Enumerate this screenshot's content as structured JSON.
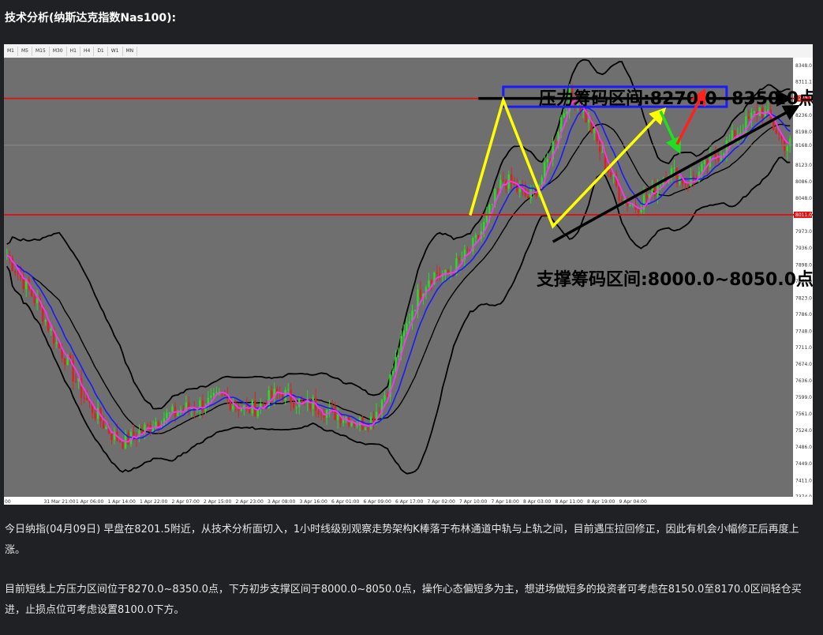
{
  "heading": "技术分析(纳斯达克指数Nas100):",
  "timeframes": [
    "M1",
    "M5",
    "M15",
    "M30",
    "H1",
    "H4",
    "D1",
    "W1",
    "MN"
  ],
  "annotations": {
    "resistance": "压力筹码区间:8270.0~8350.0点",
    "support": "支撑筹码区间:8000.0~8050.0点"
  },
  "price_labels": [
    "8348.0",
    "8311.1",
    "8273.7",
    "8236.0",
    "8198.0",
    "8168.0",
    "8123.0",
    "8086.0",
    "8048.0",
    "8011.0",
    "7973.0",
    "7936.0",
    "7898.0",
    "7861.0",
    "7823.0",
    "7786.0",
    "7748.0",
    "7711.0",
    "7674.0",
    "7636.0",
    "7599.0",
    "7561.0",
    "7524.0",
    "7486.0",
    "7449.0",
    "7411.0",
    "7374.0"
  ],
  "time_labels": [
    "00",
    "31 Mar 21:00",
    "1 Apr 06:00",
    "1 Apr 14:00",
    "1 Apr 22:00",
    "2 Apr 07:00",
    "2 Apr 15:00",
    "2 Apr 23:00",
    "3 Apr 08:00",
    "3 Apr 16:00",
    "6 Apr 01:00",
    "6 Apr 09:00",
    "6 Apr 17:00",
    "7 Apr 02:00",
    "7 Apr 10:00",
    "7 Apr 18:00",
    "8 Apr 03:00",
    "8 Apr 11:00",
    "8 Apr 19:00",
    "9 Apr 04:00"
  ],
  "paragraphs": [
    "今日纳指(04月09日) 早盘在8201.5附近，从技术分析面切入，1小时线级别观察走势架构K棒落于布林通道中轨与上轨之间，目前遇压拉回修正，因此有机会小幅修正后再度上涨。",
    "目前短线上方压力区间位于8270.0~8350.0点，下方初步支撑区间于8000.0~8050.0点，操作心态偏短多为主，想进场做短多的投资者可考虑在8150.0至8170.0区间轻仓买进，止损点位可考虑设置8100.0下方。"
  ],
  "colors": {
    "bg": "#202124",
    "plot_bg": "#6f6f6f",
    "bull": "#21e021",
    "bear": "#e02020",
    "upper_band": "#000000",
    "ma_fast": "#ff30ff",
    "ma_mid": "#1a1aff",
    "level": "#e01010",
    "arrow_yellow": "#ffff00",
    "arrow_red": "#ff2020",
    "arrow_green": "#1ee01e"
  },
  "chart_data": {
    "type": "candlestick",
    "symbol": "Nas100",
    "timeframe": "H1",
    "y_range": [
      7374.0,
      8348.0
    ],
    "current_price": 8168.0,
    "horizontal_levels": [
      8273.7,
      8011.0
    ],
    "resistance_zone": [
      8270.0,
      8350.0
    ],
    "support_zone": [
      8000.0,
      8050.0
    ],
    "closes": [
      7920,
      7890,
      7860,
      7830,
      7800,
      7760,
      7720,
      7690,
      7650,
      7610,
      7580,
      7555,
      7530,
      7510,
      7500,
      7505,
      7520,
      7530,
      7545,
      7555,
      7560,
      7570,
      7575,
      7580,
      7585,
      7590,
      7600,
      7590,
      7580,
      7570,
      7575,
      7585,
      7600,
      7610,
      7600,
      7590,
      7580,
      7585,
      7575,
      7565,
      7560,
      7555,
      7545,
      7540,
      7550,
      7580,
      7620,
      7680,
      7740,
      7800,
      7840,
      7870,
      7880,
      7870,
      7890,
      7910,
      7930,
      7960,
      8000,
      8050,
      8090,
      8080,
      8060,
      8050,
      8070,
      8110,
      8170,
      8230,
      8280,
      8270,
      8230,
      8190,
      8140,
      8100,
      8060,
      8040,
      8030,
      8045,
      8060,
      8090,
      8110,
      8100,
      8085,
      8090,
      8110,
      8130,
      8150,
      8170,
      8190,
      8210,
      8230,
      8250,
      8230,
      8200,
      8170
    ]
  }
}
